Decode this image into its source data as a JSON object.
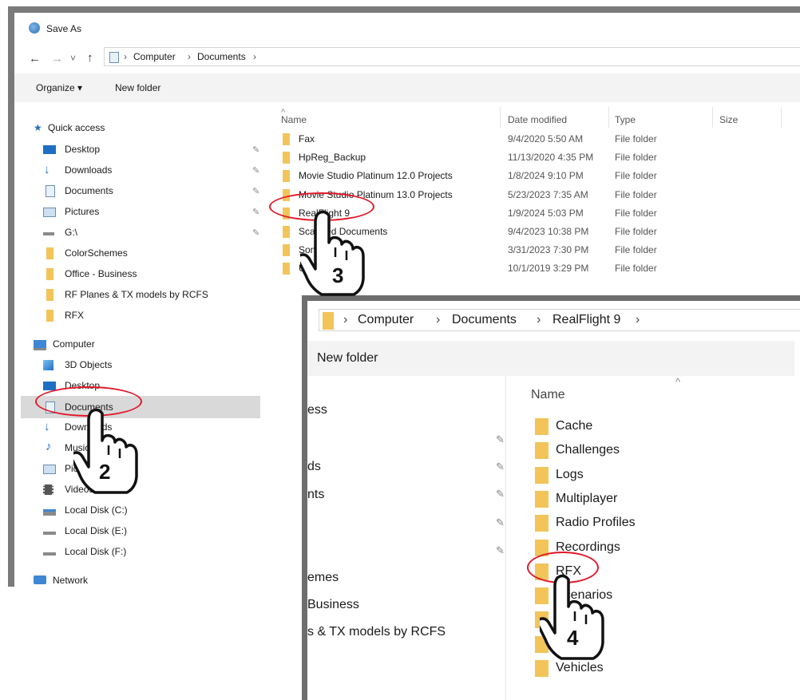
{
  "window1": {
    "title": "Save As",
    "nav": {
      "back": "←",
      "forward": "→",
      "chevron": "˅",
      "up": "↑"
    },
    "breadcrumb": [
      "Computer",
      "Documents"
    ],
    "toolbar": {
      "organize": "Organize ▾",
      "new_folder": "New folder"
    },
    "columns": {
      "name": "Name",
      "date": "Date modified",
      "type": "Type",
      "size": "Size"
    },
    "sidebar": {
      "quick_access": "Quick access",
      "quick_items": [
        {
          "label": "Desktop",
          "icon": "desktop-icon",
          "pinned": true
        },
        {
          "label": "Downloads",
          "icon": "download-icon",
          "pinned": true
        },
        {
          "label": "Documents",
          "icon": "documents-icon",
          "pinned": true
        },
        {
          "label": "Pictures",
          "icon": "pictures-icon",
          "pinned": true
        },
        {
          "label": "G:\\",
          "icon": "drive-icon",
          "pinned": true
        },
        {
          "label": "ColorSchemes",
          "icon": "folder-icon",
          "pinned": false
        },
        {
          "label": "Office - Business",
          "icon": "folder-icon",
          "pinned": false
        },
        {
          "label": "RF Planes & TX models by RCFS",
          "icon": "folder-icon",
          "pinned": false
        },
        {
          "label": "RFX",
          "icon": "folder-icon",
          "pinned": false
        }
      ],
      "computer": "Computer",
      "computer_items": [
        {
          "label": "3D Objects",
          "icon": "3d-objects-icon"
        },
        {
          "label": "Desktop",
          "icon": "desktop-icon"
        },
        {
          "label": "Documents",
          "icon": "documents-icon"
        },
        {
          "label": "Downloads",
          "icon": "download-icon"
        },
        {
          "label": "Music",
          "icon": "music-icon"
        },
        {
          "label": "Pictures",
          "icon": "pictures-icon"
        },
        {
          "label": "Videos",
          "icon": "videos-icon"
        },
        {
          "label": "Local Disk (C:)",
          "icon": "disk-icon"
        },
        {
          "label": "Local Disk (E:)",
          "icon": "disk-icon"
        },
        {
          "label": "Local Disk (F:)",
          "icon": "disk-icon"
        }
      ],
      "network": "Network"
    },
    "files": [
      {
        "name": "Fax",
        "date": "9/4/2020 5:50 AM",
        "type": "File folder"
      },
      {
        "name": "HpReg_Backup",
        "date": "11/13/2020 4:35 PM",
        "type": "File folder"
      },
      {
        "name": "Movie Studio Platinum 12.0 Projects",
        "date": "1/8/2024 9:10 PM",
        "type": "File folder"
      },
      {
        "name": "Movie Studio Platinum 13.0 Projects",
        "date": "5/23/2023 7:35 AM",
        "type": "File folder"
      },
      {
        "name": "RealFlight 9",
        "date": "1/9/2024 5:03 PM",
        "type": "File folder"
      },
      {
        "name": "Scanned Documents",
        "date": "9/4/2023 10:38 PM",
        "type": "File folder"
      },
      {
        "name": "Songs",
        "date": "3/31/2023 7:30 PM",
        "type": "File folder"
      },
      {
        "name": "Updates",
        "date": "10/1/2019 3:29 PM",
        "type": "File folder"
      }
    ]
  },
  "window2": {
    "breadcrumb": [
      "Computer",
      "Documents",
      "RealFlight 9"
    ],
    "toolbar": {
      "new_folder": "New folder"
    },
    "columns": {
      "name": "Name"
    },
    "sidebar_fragments": [
      "ess",
      "ds",
      "nts",
      "emes",
      "Business",
      "s & TX models by RCFS"
    ],
    "files": [
      "Cache",
      "Challenges",
      "Logs",
      "Multiplayer",
      "Radio Profiles",
      "Recordings",
      "RFX",
      "Scenarios",
      "Settings",
      "Temp",
      "Vehicles"
    ]
  },
  "annotations": {
    "step2": "2",
    "step3": "3",
    "step4": "4",
    "highlight_color": "#e0192a"
  }
}
